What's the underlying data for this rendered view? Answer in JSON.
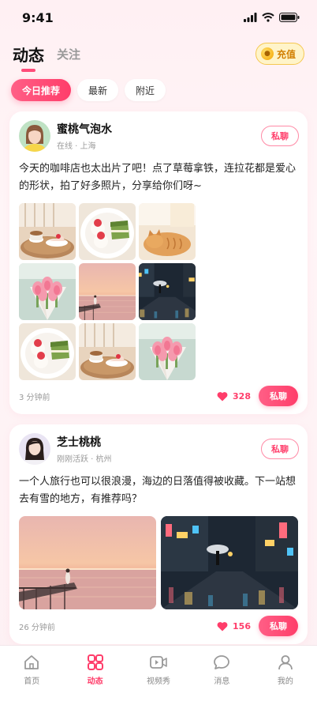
{
  "status_bar": {
    "time": "9:41"
  },
  "header": {
    "tab_active": "动态",
    "tab_inactive": "关注",
    "recharge_label": "充值"
  },
  "filters": [
    {
      "label": "今日推荐"
    },
    {
      "label": "最新"
    },
    {
      "label": "附近"
    }
  ],
  "posts": [
    {
      "user_name": "蜜桃气泡水",
      "status": "在线",
      "city": "上海",
      "message_button": "私聊",
      "text": "今天的咖啡店也太出片了吧！点了草莓拿铁，连拉花都是爱心的形状，拍了好多照片，分享给你们呀~",
      "time": "3 分钟前",
      "likes": "328",
      "chat_button": "私聊"
    },
    {
      "user_name": "芝士桃桃",
      "status": "刚刚活跃",
      "city": "杭州",
      "message_button": "私聊",
      "text": "一个人旅行也可以很浪漫，海边的日落值得被收藏。下一站想去有雪的地方，有推荐吗？",
      "time": "26 分钟前",
      "likes": "156",
      "chat_button": "私聊"
    }
  ],
  "tabbar": [
    {
      "label": "首页"
    },
    {
      "label": "动态"
    },
    {
      "label": "视频秀"
    },
    {
      "label": "消息"
    },
    {
      "label": "我的"
    }
  ],
  "colors": {
    "accent": "#ff3d6a",
    "gold": "#f5c851"
  }
}
